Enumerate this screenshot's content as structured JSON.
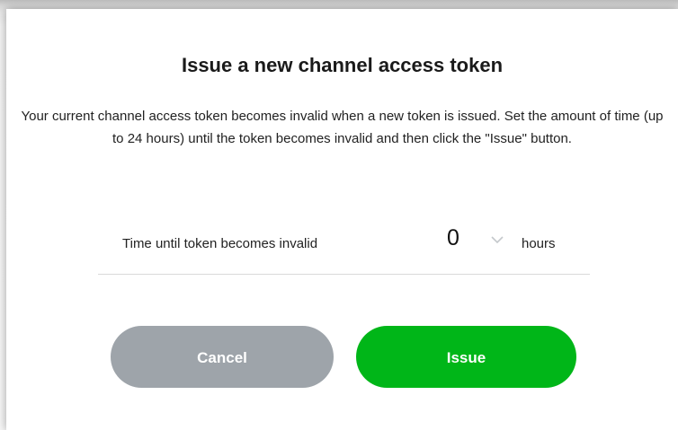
{
  "dialog": {
    "title": "Issue a new channel access token",
    "description": "Your current channel access token becomes invalid when a new token is issued. Set the amount of time (up to 24 hours) until the token becomes invalid and then click the \"Issue\" button."
  },
  "expiry": {
    "label": "Time until token becomes invalid",
    "selected_value": "0",
    "unit": "hours",
    "chevron_icon": "chevron-down-icon"
  },
  "actions": {
    "cancel_label": "Cancel",
    "issue_label": "Issue"
  },
  "colors": {
    "cancel_button": "#9ea4aa",
    "issue_button": "#00b618",
    "divider": "#d9d9d9"
  }
}
